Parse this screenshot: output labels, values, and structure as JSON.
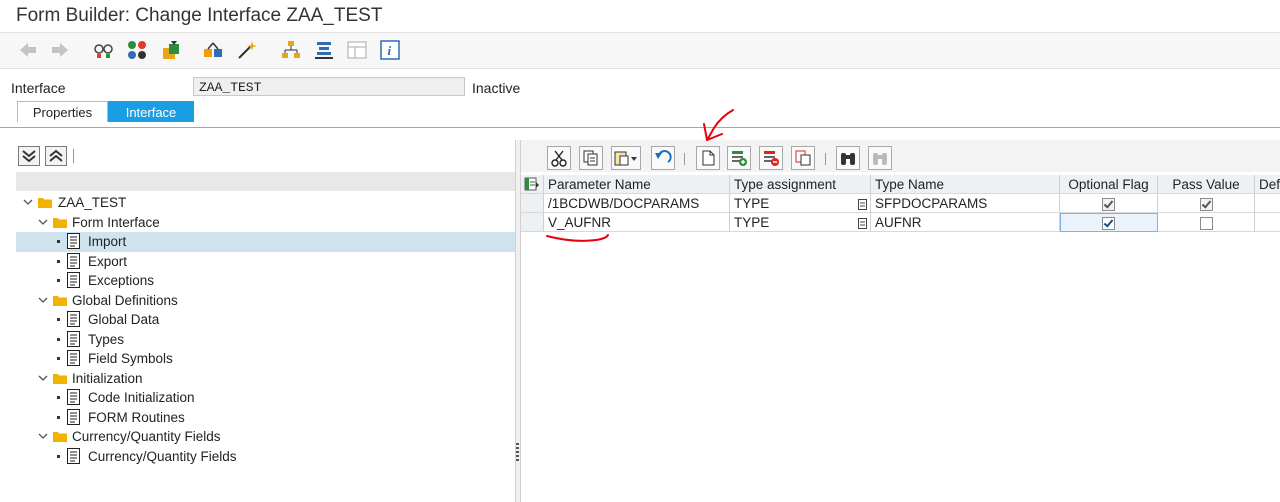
{
  "window": {
    "title": "Form Builder: Change Interface ZAA_TEST"
  },
  "toolbar": {
    "icons": [
      "back-icon",
      "forward-icon",
      "other-object-icon",
      "display-change-icon",
      "activate-icon",
      "check-icon",
      "test-icon",
      "hierarchy-icon",
      "layout-icon",
      "form-icon",
      "info-icon"
    ]
  },
  "interface_row": {
    "label": "Interface",
    "value": "ZAA_TEST",
    "status": "Inactive"
  },
  "tabs": [
    {
      "label": "Properties"
    },
    {
      "label": "Interface"
    }
  ],
  "tree": {
    "items": [
      {
        "label": "ZAA_TEST"
      },
      {
        "label": "Form Interface"
      },
      {
        "label": "Import"
      },
      {
        "label": "Export"
      },
      {
        "label": "Exceptions"
      },
      {
        "label": "Global Definitions"
      },
      {
        "label": "Global Data"
      },
      {
        "label": "Types"
      },
      {
        "label": "Field Symbols"
      },
      {
        "label": "Initialization"
      },
      {
        "label": "Code Initialization"
      },
      {
        "label": "FORM Routines"
      },
      {
        "label": "Currency/Quantity Fields"
      },
      {
        "label": "Currency/Quantity Fields"
      }
    ]
  },
  "grid": {
    "columns": [
      "Parameter Name",
      "Type assignment",
      "Type Name",
      "Optional Flag",
      "Pass Value",
      "Defa"
    ],
    "rows": [
      {
        "param": "/1BCDWB/DOCPARAMS",
        "type_assign": "TYPE",
        "type_name": "SFPDOCPARAMS",
        "optional": true,
        "pass_value": true
      },
      {
        "param": "V_AUFNR",
        "type_assign": "TYPE",
        "type_name": "AUFNR",
        "optional": true,
        "pass_value": false
      }
    ]
  },
  "colors": {
    "accent": "#1b9de2",
    "selection": "#cfe3ef",
    "annotation": "#e8000b",
    "tabline": "#d8a437"
  }
}
